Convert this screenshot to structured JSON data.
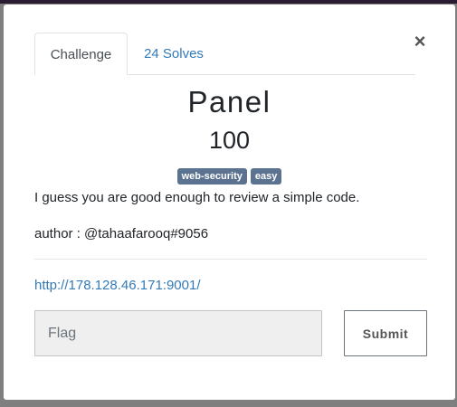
{
  "tabs": [
    {
      "label": "Challenge",
      "active": true
    },
    {
      "label": "24 Solves",
      "active": false
    }
  ],
  "close_symbol": "×",
  "challenge": {
    "name": "Panel",
    "points": "100",
    "tags": [
      "web-security",
      "easy"
    ],
    "description": "I guess you are good enough to review a simple code.",
    "author": "author : @tahaafarooq#9056",
    "link": "http://178.128.46.171:9001/"
  },
  "form": {
    "flag_placeholder": "Flag",
    "flag_value": "",
    "submit_label": "Submit"
  },
  "colors": {
    "accent_link": "#337ab7",
    "tag_bg": "#5b7290",
    "overlay": "#7f7f7f"
  }
}
